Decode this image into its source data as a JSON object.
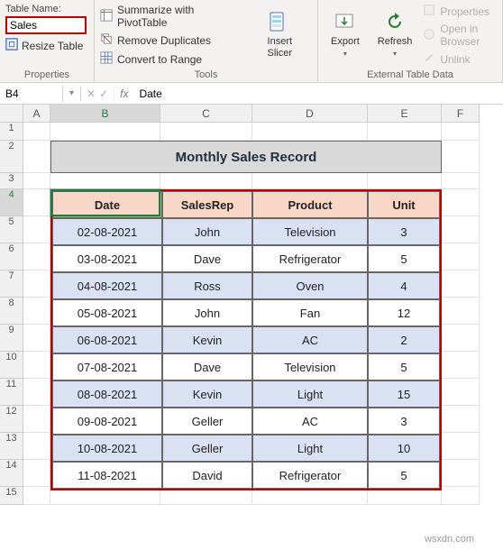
{
  "ribbon": {
    "properties": {
      "label": "Properties",
      "table_name_label": "Table Name:",
      "table_name_value": "Sales",
      "resize_label": "Resize Table"
    },
    "tools": {
      "label": "Tools",
      "summarize": "Summarize with PivotTable",
      "remove_dup": "Remove Duplicates",
      "convert_range": "Convert to Range",
      "insert_slicer": "Insert\nSlicer"
    },
    "external": {
      "label": "External Table Data",
      "export": "Export",
      "refresh": "Refresh",
      "properties": "Properties",
      "open_browser": "Open in Browser",
      "unlink": "Unlink"
    }
  },
  "formula_bar": {
    "name_box": "B4",
    "formula": "Date"
  },
  "columns": [
    "A",
    "B",
    "C",
    "D",
    "E",
    "F"
  ],
  "rows": [
    "1",
    "2",
    "3",
    "4",
    "5",
    "6",
    "7",
    "8",
    "9",
    "10",
    "11",
    "12",
    "13",
    "14",
    "15"
  ],
  "sheet": {
    "title": "Monthly Sales Record",
    "headers": [
      "Date",
      "SalesRep",
      "Product",
      "Unit"
    ],
    "data": [
      [
        "02-08-2021",
        "John",
        "Television",
        "3"
      ],
      [
        "03-08-2021",
        "Dave",
        "Refrigerator",
        "5"
      ],
      [
        "04-08-2021",
        "Ross",
        "Oven",
        "4"
      ],
      [
        "05-08-2021",
        "John",
        "Fan",
        "12"
      ],
      [
        "06-08-2021",
        "Kevin",
        "AC",
        "2"
      ],
      [
        "07-08-2021",
        "Dave",
        "Television",
        "5"
      ],
      [
        "08-08-2021",
        "Kevin",
        "Light",
        "15"
      ],
      [
        "09-08-2021",
        "Geller",
        "AC",
        "3"
      ],
      [
        "10-08-2021",
        "Geller",
        "Light",
        "10"
      ],
      [
        "11-08-2021",
        "David",
        "Refrigerator",
        "5"
      ]
    ]
  },
  "watermark": "wsxdn.com"
}
